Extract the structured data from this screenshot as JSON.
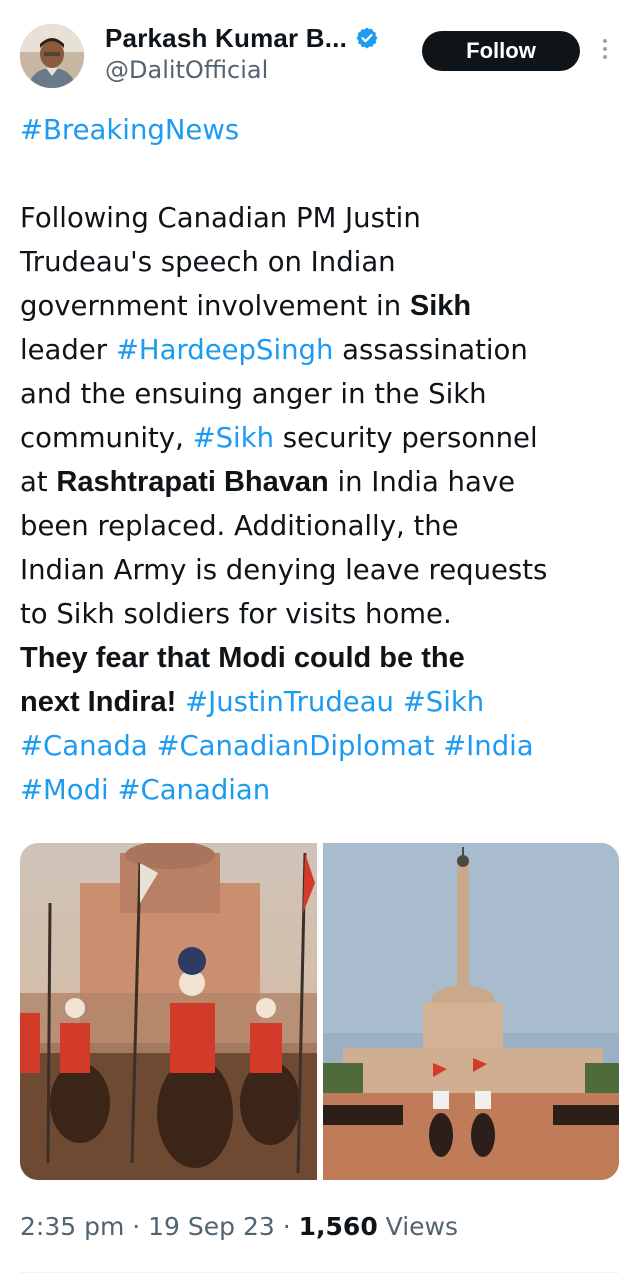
{
  "author": {
    "display_name": "Parkash Kumar B...",
    "handle": "@DalitOfficial",
    "verified": true,
    "avatar_icon": "user-avatar"
  },
  "follow_label": "Follow",
  "more_icon": "vertical-ellipsis-icon",
  "tweet": {
    "line1": "#BreakingNews",
    "line2": " Following Canadian PM Justin",
    "line3": "Trudeau's speech on Indian",
    "line4_pre": "government involvement in ",
    "line4_bold": "Sikh",
    "line5_pre": "leader ",
    "line5_tag": "#HardeepSingh",
    "line5_post": " assassination",
    "line6": "and the ensuing anger in the Sikh",
    "line7_pre": "community, ",
    "line7_tag": "#Sikh",
    "line7_post": " security personnel",
    "line8_pre": "at ",
    "line8_bold": "Rashtrapati Bhavan",
    "line8_post": " in India have",
    "line9": "been replaced. Additionally, the",
    "line10": "Indian Army is denying leave requests",
    "line11": "to Sikh soldiers for visits home.",
    "line12_bold": "They fear that Modi could be the",
    "line13_bold": "next Indira!",
    "line13_tag1": "#JustinTrudeau",
    "line13_tag2": "#Sikh",
    "line14_tag1": "#Canada",
    "line14_tag2": "#CanadianDiplomat",
    "line14_tag3": "#India",
    "line15_tag1": "#Modi",
    "line15_tag2": "#Canadian"
  },
  "meta": {
    "time": "2:35 pm",
    "sep": " · ",
    "date": "19 Sep 23",
    "views_count": "1,560",
    "views_label": " Views"
  },
  "colors": {
    "link": "#1d9bf0",
    "text": "#0f1419",
    "secondary": "#536471",
    "button": "#0f1419"
  }
}
